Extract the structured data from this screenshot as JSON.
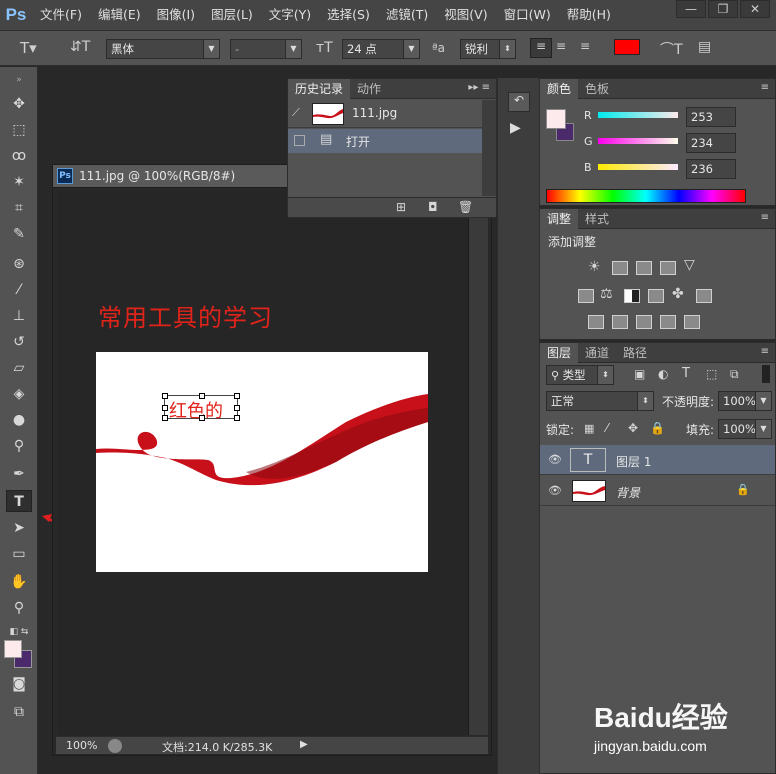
{
  "app": {
    "logo": "Ps"
  },
  "menu": [
    "文件(F)",
    "编辑(E)",
    "图像(I)",
    "图层(L)",
    "文字(Y)",
    "选择(S)",
    "滤镜(T)",
    "视图(V)",
    "窗口(W)",
    "帮助(H)"
  ],
  "window_controls": {
    "minimize": "—",
    "restore": "❐",
    "close": "✕"
  },
  "options": {
    "font_family": "黑体",
    "font_style": "-",
    "font_size": "24 点",
    "antialias": "锐利",
    "text_color": "#ff0000"
  },
  "document": {
    "tab_title": "111.jpg @ 100%(RGB/8#)",
    "heading_text": "常用工具的学习",
    "text_layer_content": "红色的",
    "zoom": "100%",
    "doc_info": "文档:214.0 K/285.3K"
  },
  "history": {
    "tabs": [
      "历史记录",
      "动作"
    ],
    "snapshot_name": "111.jpg",
    "items": [
      "打开"
    ]
  },
  "color_panel": {
    "tabs": [
      "颜色",
      "色板"
    ],
    "r_label": "R",
    "r_value": "253",
    "g_label": "G",
    "g_value": "234",
    "b_label": "B",
    "b_value": "236",
    "foreground": "#fdeaec",
    "background": "#4a2a6a"
  },
  "adjustments": {
    "tabs": [
      "调整",
      "样式"
    ],
    "title": "添加调整"
  },
  "layers": {
    "tabs": [
      "图层",
      "通道",
      "路径"
    ],
    "filter_kind": "类型",
    "blend_mode": "正常",
    "opacity_label": "不透明度:",
    "opacity_value": "100%",
    "lock_label": "锁定:",
    "fill_label": "填充:",
    "fill_value": "100%",
    "items": [
      {
        "name": "图层 1",
        "type": "text",
        "thumb": "T"
      },
      {
        "name": "背景",
        "type": "image"
      }
    ]
  },
  "watermark": {
    "brand": "Baidu经验",
    "url": "jingyan.baidu.com"
  }
}
